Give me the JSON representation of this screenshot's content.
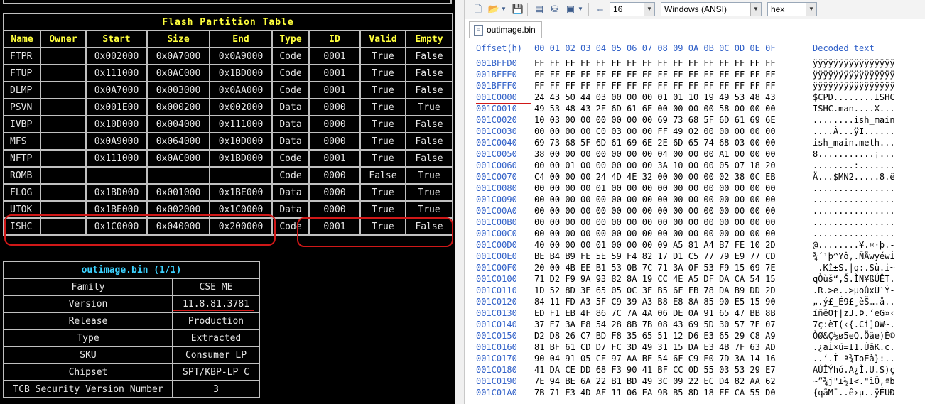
{
  "partition_table": {
    "caption": "Flash Partition Table",
    "headers": [
      "Name",
      "Owner",
      "Start",
      "Size",
      "End",
      "Type",
      "ID",
      "Valid",
      "Empty"
    ],
    "rows": [
      [
        "FTPR",
        "",
        "0x002000",
        "0x0A7000",
        "0x0A9000",
        "Code",
        "0001",
        "True",
        "False"
      ],
      [
        "FTUP",
        "",
        "0x111000",
        "0x0AC000",
        "0x1BD000",
        "Code",
        "0001",
        "True",
        "False"
      ],
      [
        "DLMP",
        "",
        "0x0A7000",
        "0x003000",
        "0x0AA000",
        "Code",
        "0001",
        "True",
        "False"
      ],
      [
        "PSVN",
        "",
        "0x001E00",
        "0x000200",
        "0x002000",
        "Data",
        "0000",
        "True",
        "True"
      ],
      [
        "IVBP",
        "",
        "0x10D000",
        "0x004000",
        "0x111000",
        "Data",
        "0000",
        "True",
        "False"
      ],
      [
        "MFS",
        "",
        "0x0A9000",
        "0x064000",
        "0x10D000",
        "Data",
        "0000",
        "True",
        "False"
      ],
      [
        "NFTP",
        "",
        "0x111000",
        "0x0AC000",
        "0x1BD000",
        "Code",
        "0001",
        "True",
        "False"
      ],
      [
        "ROMB",
        "",
        "",
        "",
        "",
        "Code",
        "0000",
        "False",
        "True"
      ],
      [
        "FLOG",
        "",
        "0x1BD000",
        "0x001000",
        "0x1BE000",
        "Data",
        "0000",
        "True",
        "True"
      ],
      [
        "UTOK",
        "",
        "0x1BE000",
        "0x002000",
        "0x1C0000",
        "Data",
        "0000",
        "True",
        "True"
      ],
      [
        "ISHC",
        "",
        "0x1C0000",
        "0x040000",
        "0x200000",
        "Code",
        "0001",
        "True",
        "False"
      ]
    ]
  },
  "info_table": {
    "caption": "outimage.bin (1/1)",
    "rows": [
      [
        "Family",
        "CSE ME"
      ],
      [
        "Version",
        "11.8.81.3781"
      ],
      [
        "Release",
        "Production"
      ],
      [
        "Type",
        "Extracted"
      ],
      [
        "SKU",
        "Consumer LP"
      ],
      [
        "Chipset",
        "SPT/KBP-LP C"
      ],
      [
        "TCB Security Version Number",
        "3"
      ]
    ]
  },
  "toolbar": {
    "bytes_per_row": "16",
    "encoding": "Windows (ANSI)",
    "display_mode": "hex"
  },
  "tab": {
    "filename": "outimage.bin"
  },
  "hex": {
    "header_offset": "Offset(h)",
    "header_columns": "00 01 02 03 04 05 06 07 08 09 0A 0B 0C 0D 0E 0F",
    "header_decoded": "Decoded text",
    "rows": [
      {
        "o": "001BFFD0",
        "b": "FF FF FF FF FF FF FF FF FF FF FF FF FF FF FF FF",
        "d": "ÿÿÿÿÿÿÿÿÿÿÿÿÿÿÿÿ"
      },
      {
        "o": "001BFFE0",
        "b": "FF FF FF FF FF FF FF FF FF FF FF FF FF FF FF FF",
        "d": "ÿÿÿÿÿÿÿÿÿÿÿÿÿÿÿÿ"
      },
      {
        "o": "001BFFF0",
        "b": "FF FF FF FF FF FF FF FF FF FF FF FF FF FF FF FF",
        "d": "ÿÿÿÿÿÿÿÿÿÿÿÿÿÿÿÿ"
      },
      {
        "o": "001C0000",
        "b": "24 43 50 44 03 00 00 00 01 01 10 19 49 53 48 43",
        "d": "$CPD........ISHC"
      },
      {
        "o": "001C0010",
        "b": "49 53 48 43 2E 6D 61 6E 00 00 00 00 58 00 00 00",
        "d": "ISHC.man....X..."
      },
      {
        "o": "001C0020",
        "b": "10 03 00 00 00 00 00 00 69 73 68 5F 6D 61 69 6E",
        "d": "........ish_main"
      },
      {
        "o": "001C0030",
        "b": "00 00 00 00 C0 03 00 00 FF 49 02 00 00 00 00 00",
        "d": "....À...ÿI......"
      },
      {
        "o": "001C0040",
        "b": "69 73 68 5F 6D 61 69 6E 2E 6D 65 74 68 03 00 00",
        "d": "ish_main.meth..."
      },
      {
        "o": "001C0050",
        "b": "38 00 00 00 00 00 00 00 04 00 00 00 A1 00 00 00",
        "d": "8...........¡..."
      },
      {
        "o": "001C0060",
        "b": "00 00 01 00 00 00 00 00 3A 10 00 00 05 07 18 20",
        "d": "........:......."
      },
      {
        "o": "001C0070",
        "b": "C4 00 00 00 24 4D 4E 32 00 00 00 00 02 38 0C EB",
        "d": "Ä...$MN2.....8.ë"
      },
      {
        "o": "001C0080",
        "b": "00 00 00 00 01 00 00 00 00 00 00 00 00 00 00 00",
        "d": "................"
      },
      {
        "o": "001C0090",
        "b": "00 00 00 00 00 00 00 00 00 00 00 00 00 00 00 00",
        "d": "................"
      },
      {
        "o": "001C00A0",
        "b": "00 00 00 00 00 00 00 00 00 00 00 00 00 00 00 00",
        "d": "................"
      },
      {
        "o": "001C00B0",
        "b": "00 00 00 00 00 00 00 00 00 00 00 00 00 00 00 00",
        "d": "................"
      },
      {
        "o": "001C00C0",
        "b": "00 00 00 00 00 00 00 00 00 00 00 00 00 00 00 00",
        "d": "................"
      },
      {
        "o": "001C00D0",
        "b": "40 00 00 00 01 00 00 00 09 A5 81 A4 B7 FE 10 2D",
        "d": "@........¥.¤·þ.-"
      },
      {
        "o": "001C00E0",
        "b": "BE B4 B9 FE 5E 59 F4 82 17 D1 C5 77 79 E9 77 CD",
        "d": "¾´¹þ^Yô‚.ÑÅwyéwÍ"
      },
      {
        "o": "001C00F0",
        "b": "20 00 4B EE B1 53 0B 7C 71 3A 0F 53 F9 15 69 7E",
        "d": " .Kî±S.|q:.Sù.i~"
      },
      {
        "o": "001C0100",
        "b": "71 D2 F9 9A 93 82 8A 19 CC 4E A5 DF DA CA 54 15",
        "d": "qÒùš“‚Š.ÌN¥ßÚÊT."
      },
      {
        "o": "001C0110",
        "b": "1D 52 8D 3E 65 05 0C 3E B5 6F FB 78 DA B9 DD 2D",
        "d": ".R.>e..>µoûxÚ¹Ý-"
      },
      {
        "o": "001C0120",
        "b": "84 11 FD A3 5F C9 39 A3 B8 E8 8A 85 90 E5 15 90",
        "d": "„.ý£_É9£¸èŠ….å.."
      },
      {
        "o": "001C0130",
        "b": "ED F1 EB 4F 86 7C 7A 4A 06 DE 0A 91 65 47 BB 8B",
        "d": "íñëO†|zJ.Þ.‘eG»‹"
      },
      {
        "o": "001C0140",
        "b": "37 E7 3A E8 54 28 8B 7B 08 43 69 5D 30 57 7E 07",
        "d": "7ç:èT(‹{.Ci]0W~."
      },
      {
        "o": "001C0150",
        "b": "D2 D8 26 C7 BD F8 35 65 51 12 D6 E3 65 29 C8 A9",
        "d": "ÒØ&Ç½ø5eQ.Öãe)È©"
      },
      {
        "o": "001C0160",
        "b": "81 BF 61 CD D7 FC 3D 49 31 15 DA E3 4B 7F 63 AD",
        "d": ".¿aÍ×ü=I1.ÚãK.c."
      },
      {
        "o": "001C0170",
        "b": "90 04 91 05 CE 97 AA BE 54 6F C9 E0 7D 3A 14 16",
        "d": "..‘.Î—ª¾ToÉà}:.."
      },
      {
        "o": "001C0180",
        "b": "41 DA CE DD 68 F3 90 41 BF CC 0D 55 03 53 29 E7",
        "d": "AÚÎÝhó.A¿Ì.U.S)ç"
      },
      {
        "o": "001C0190",
        "b": "7E 94 BE 6A 22 B1 BD 49 3C 09 22 EC D4 82 AA 62",
        "d": "~”¾j\"±½I<.\"ìÔ‚ªb"
      },
      {
        "o": "001C01A0",
        "b": "7B 71 E3 4D AF 11 06 EA 9B B5 8D 18 FF CA 55 D0",
        "d": "{qãM¯..ê›µ..ÿÊUÐ"
      }
    ]
  }
}
